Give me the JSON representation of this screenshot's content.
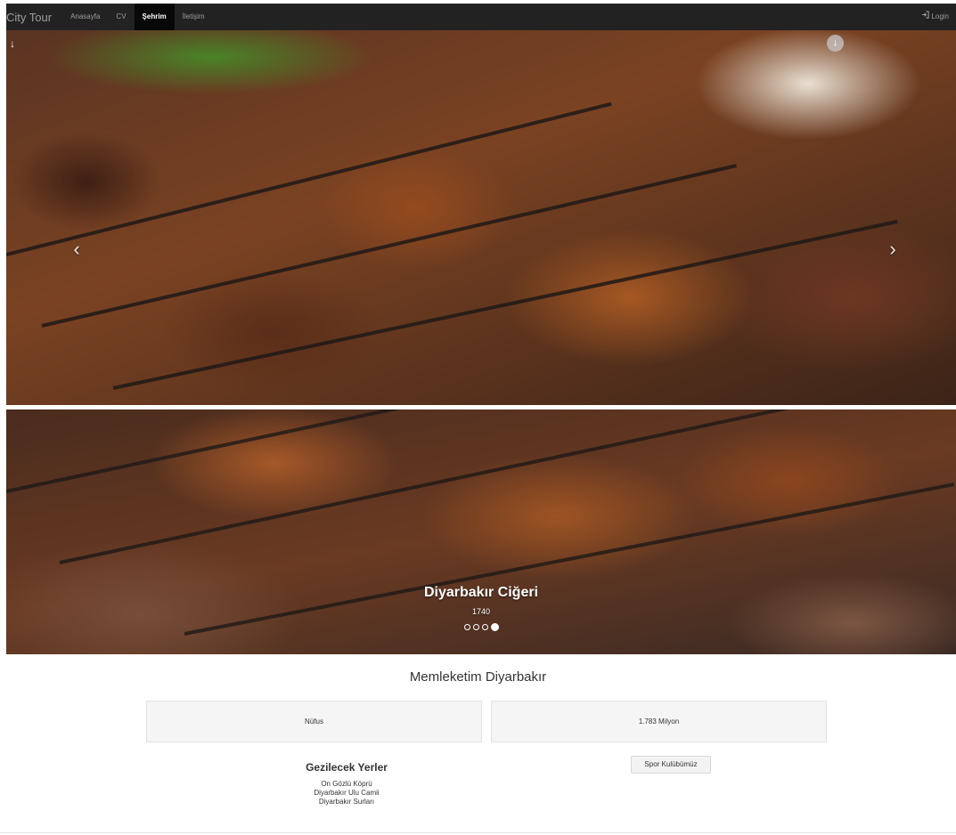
{
  "navbar": {
    "brand": "City Tour",
    "items": [
      {
        "label": "Anasayfa",
        "active": false
      },
      {
        "label": "CV",
        "active": false
      },
      {
        "label": "Şehrim",
        "active": true
      },
      {
        "label": "İletişim",
        "active": false
      }
    ],
    "login_label": "Login",
    "login_icon": "login-icon"
  },
  "carousel": {
    "icons": {
      "prev": "chevron-left-icon",
      "next": "chevron-right-icon",
      "down_left": "arrow-down-icon",
      "down_right": "arrow-down-circle-icon"
    },
    "caption_title": "Diyarbakır Ciğeri",
    "caption_year": "1740",
    "indicator_count": 4,
    "active_indicator": 4
  },
  "main": {
    "title": "Memleketim Diyarbakır",
    "population_label": "Nüfus",
    "population_value": "1.783 Milyon",
    "places_title": "Gezilecek Yerler",
    "places": [
      "On Gözlü Köprü",
      "Diyarbakır Ulu Camii",
      "Diyarbakır Surları"
    ],
    "sport_button": "Spor Kulübümüz"
  },
  "colors": {
    "navbar_bg": "#222222",
    "nav_text": "#9d9d9d",
    "nav_active_text": "#ffffff",
    "card_bg": "#f5f5f5"
  }
}
